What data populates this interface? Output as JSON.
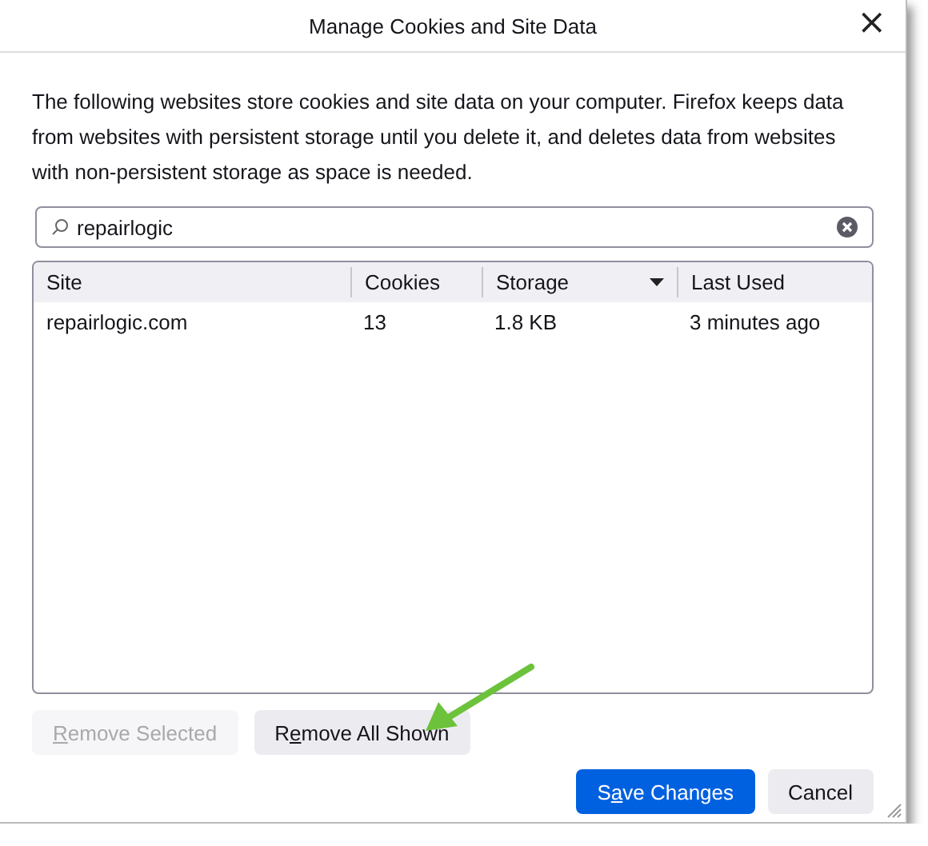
{
  "window": {
    "title": "Manage Cookies and Site Data",
    "close": "×"
  },
  "description": "The following websites store cookies and site data on your computer. Firefox keeps data from websites with persistent storage until you delete it, and deletes data from websites with non-persistent storage as space is needed.",
  "search": {
    "value": "repairlogic"
  },
  "table": {
    "columns": [
      {
        "label": "Site",
        "sorted": false
      },
      {
        "label": "Cookies",
        "sorted": false
      },
      {
        "label": "Storage",
        "sorted": true
      },
      {
        "label": "Last Used",
        "sorted": false
      }
    ],
    "rows": [
      {
        "cells": [
          "repairlogic.com",
          "13",
          "1.8 KB",
          "3 minutes ago"
        ],
        "selected": false
      }
    ]
  },
  "list_buttons": [
    {
      "key": "R",
      "post": "emove Selected",
      "disabled": true
    },
    {
      "pre": "R",
      "key": "e",
      "post": "move All Shown",
      "disabled": false
    }
  ],
  "dialog_buttons": [
    {
      "pre": "S",
      "key": "a",
      "post": "ve Changes",
      "primary": true
    },
    {
      "pre": "Cancel",
      "primary": false
    }
  ]
}
